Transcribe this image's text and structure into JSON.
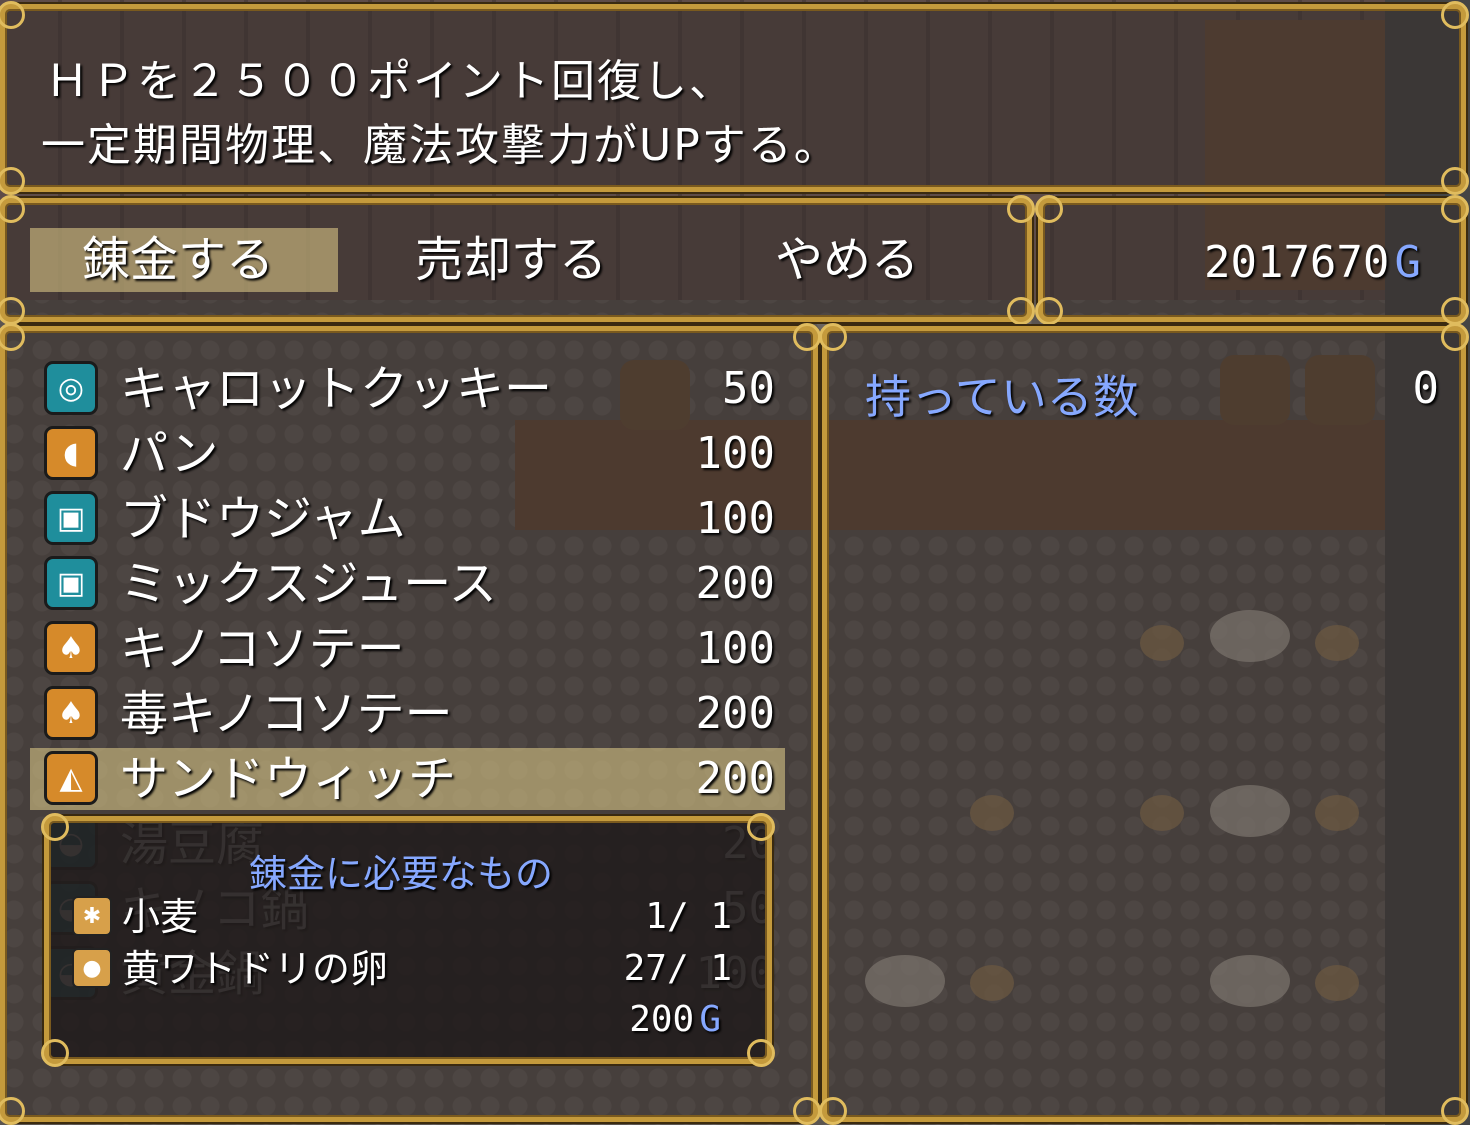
{
  "help": {
    "line1": "ＨＰを２５００ポイント回復し、",
    "line2": "一定期間物理、魔法攻撃力がUPする。"
  },
  "commands": {
    "alchemy": "錬金する",
    "sell": "売却する",
    "cancel": "やめる"
  },
  "gold": {
    "amount": "2017670",
    "unit": "G"
  },
  "items": [
    {
      "name": "キャロットクッキー",
      "price": "50",
      "icon": "cookie-icon",
      "color": "teal"
    },
    {
      "name": "パン",
      "price": "100",
      "icon": "bread-icon",
      "color": "orange"
    },
    {
      "name": "ブドウジャム",
      "price": "100",
      "icon": "jar-icon",
      "color": "teal"
    },
    {
      "name": "ミックスジュース",
      "price": "200",
      "icon": "jar-icon",
      "color": "teal"
    },
    {
      "name": "キノコソテー",
      "price": "100",
      "icon": "mushroom-icon",
      "color": "orange"
    },
    {
      "name": "毒キノコソテー",
      "price": "200",
      "icon": "mushroom-icon",
      "color": "orange"
    },
    {
      "name": "サンドウィッチ",
      "price": "200",
      "icon": "sandwich-icon",
      "color": "orange",
      "selected": true
    },
    {
      "name": "湯豆腐",
      "price": "20",
      "icon": "pot-icon",
      "color": "teal"
    },
    {
      "name": "キノコ鍋",
      "price": "50",
      "icon": "pot-icon",
      "color": "teal"
    },
    {
      "name": "黄金鍋",
      "price": "100",
      "icon": "pot-icon",
      "color": "teal"
    }
  ],
  "possession": {
    "label": "持っている数",
    "count": "0"
  },
  "requirements": {
    "title": "錬金に必要なもの",
    "materials": [
      {
        "name": "小麦",
        "have": "1/",
        "need": "1",
        "icon": "wheat-icon"
      },
      {
        "name": "黄ワトドリの卵",
        "have": "27/",
        "need": "1",
        "icon": "egg-icon"
      }
    ],
    "cost": "200",
    "cost_unit": "G"
  },
  "colors": {
    "frame": "#c49a3c",
    "system_text": "#86a8ff",
    "highlight": "#e6d28c"
  }
}
